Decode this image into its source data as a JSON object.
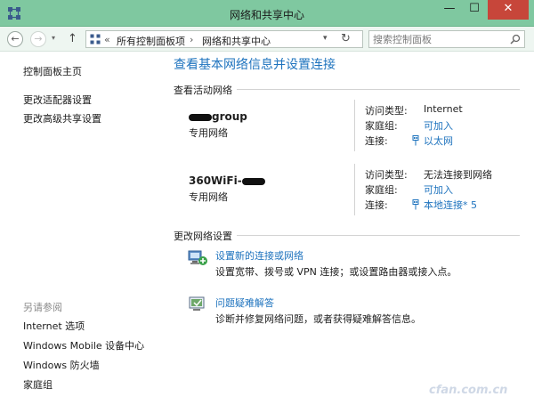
{
  "window": {
    "title": "网络和共享中心",
    "min_glyph": "—",
    "max_glyph": "☐",
    "close_glyph": "✕"
  },
  "nav": {
    "back_glyph": "←",
    "forward_glyph": "→",
    "recent_glyph": "▾",
    "up_glyph": "↑",
    "crumb_sep": "«",
    "crumb_arrow": "›",
    "crumbs": [
      "所有控制面板项",
      "网络和共享中心"
    ],
    "dropdown_glyph": "▾",
    "refresh_glyph": "↻",
    "search_placeholder": "搜索控制面板"
  },
  "sidebar": {
    "home": "控制面板主页",
    "links": [
      "更改适配器设置",
      "更改高级共享设置"
    ],
    "see_also_title": "另请参阅",
    "see_also": [
      "Internet 选项",
      "Windows Mobile 设备中心",
      "Windows 防火墙",
      "家庭组"
    ]
  },
  "main": {
    "title": "查看基本网络信息并设置连接",
    "active_header": "查看活动网络",
    "networks": [
      {
        "name_suffix": "group",
        "category": "专用网络",
        "access_label": "访问类型:",
        "access_value": "Internet",
        "homegroup_label": "家庭组:",
        "homegroup_value": "可加入",
        "conn_label": "连接:",
        "conn_value": "以太网"
      },
      {
        "name_prefix": "360WiFi-",
        "category": "专用网络",
        "access_label": "访问类型:",
        "access_value": "无法连接到网络",
        "homegroup_label": "家庭组:",
        "homegroup_value": "可加入",
        "conn_label": "连接:",
        "conn_value": "本地连接* 5"
      }
    ],
    "change_header": "更改网络设置",
    "tasks": [
      {
        "icon": "new-connection-icon",
        "link": "设置新的连接或网络",
        "desc": "设置宽带、拨号或 VPN 连接；或设置路由器或接入点。"
      },
      {
        "icon": "troubleshoot-icon",
        "link": "问题疑难解答",
        "desc": "诊断并修复网络问题，或者获得疑难解答信息。"
      }
    ]
  },
  "watermark": "cfan.com.cn",
  "colors": {
    "titlebar": "#7fc8a0",
    "link": "#1e73be",
    "close": "#c7463a"
  }
}
